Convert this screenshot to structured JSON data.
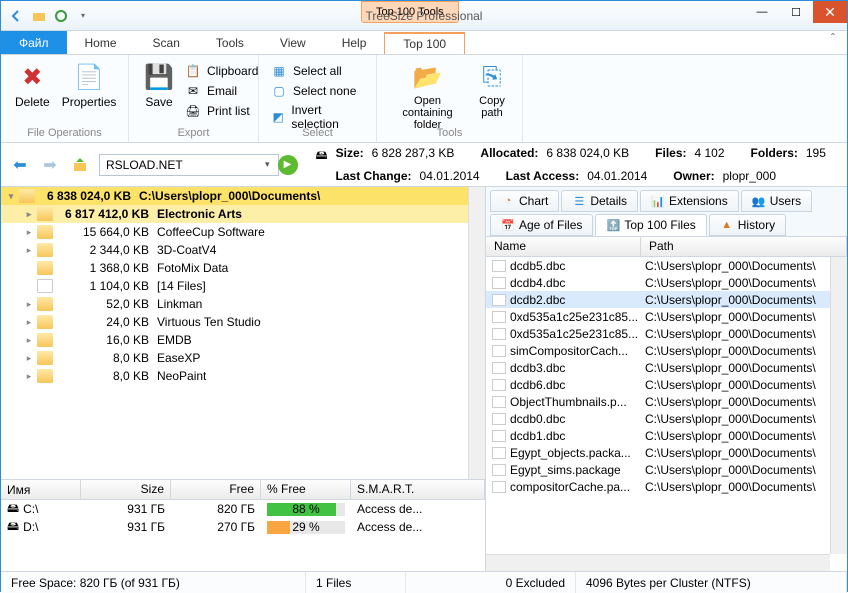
{
  "window": {
    "context_tab": "Top 100 Tools",
    "title": "TreeSize Professional"
  },
  "tabs": {
    "file": "Файл",
    "home": "Home",
    "scan": "Scan",
    "tools": "Tools",
    "view": "View",
    "help": "Help",
    "top100": "Top 100"
  },
  "ribbon": {
    "delete": "Delete",
    "properties": "Properties",
    "save": "Save",
    "clipboard": "Clipboard",
    "email": "Email",
    "printlist": "Print list",
    "selectall": "Select all",
    "selectnone": "Select none",
    "invert": "Invert selection",
    "openfolder": "Open containing\nfolder",
    "copypath": "Copy\npath",
    "g_fileops": "File Operations",
    "g_export": "Export",
    "g_select": "Select",
    "g_tools": "Tools"
  },
  "address": "RSLOAD.NET",
  "info": {
    "size_lbl": "Size:",
    "size": "6 828 287,3 KB",
    "alloc_lbl": "Allocated:",
    "alloc": "6 838 024,0 KB",
    "files_lbl": "Files:",
    "files": "4 102",
    "folders_lbl": "Folders:",
    "folders": "195",
    "lc_lbl": "Last Change:",
    "lc": "04.01.2014",
    "la_lbl": "Last Access:",
    "la": "04.01.2014",
    "owner_lbl": "Owner:",
    "owner": "plopr_000"
  },
  "tree": [
    {
      "sel": 1,
      "ind": 0,
      "exp": "▾",
      "size": "6 838 024,0 KB",
      "name": "C:\\Users\\plopr_000\\Documents\\",
      "bold": true
    },
    {
      "sel": 2,
      "ind": 1,
      "exp": "▸",
      "size": "6 817 412,0 KB",
      "name": "Electronic Arts",
      "bold": true
    },
    {
      "ind": 1,
      "exp": "▸",
      "size": "15 664,0 KB",
      "name": "CoffeeCup Software"
    },
    {
      "ind": 1,
      "exp": "▸",
      "size": "2 344,0 KB",
      "name": "3D-CoatV4"
    },
    {
      "ind": 1,
      "exp": "",
      "size": "1 368,0 KB",
      "name": "FotoMix Data"
    },
    {
      "ind": 1,
      "exp": "",
      "size": "1 104,0 KB",
      "name": "[14 Files]",
      "file": true
    },
    {
      "ind": 1,
      "exp": "▸",
      "size": "52,0 KB",
      "name": "Linkman"
    },
    {
      "ind": 1,
      "exp": "▸",
      "size": "24,0 KB",
      "name": "Virtuous Ten Studio"
    },
    {
      "ind": 1,
      "exp": "▸",
      "size": "16,0 KB",
      "name": "EMDB"
    },
    {
      "ind": 1,
      "exp": "▸",
      "size": "8,0 KB",
      "name": "EaseXP"
    },
    {
      "ind": 1,
      "exp": "▸",
      "size": "8,0 KB",
      "name": "NeoPaint"
    }
  ],
  "drives": {
    "hdr": {
      "name": "Имя",
      "size": "Size",
      "free": "Free",
      "pfree": "% Free",
      "smart": "S.M.A.R.T."
    },
    "rows": [
      {
        "name": "C:\\",
        "size": "931 ГБ",
        "free": "820 ГБ",
        "pct": "88 %",
        "pctv": 88,
        "smart": "Access de..."
      },
      {
        "name": "D:\\",
        "size": "931 ГБ",
        "free": "270 ГБ",
        "pct": "29 %",
        "pctv": 29,
        "smart": "Access de..."
      }
    ]
  },
  "ptabs": {
    "chart": "Chart",
    "details": "Details",
    "ext": "Extensions",
    "users": "Users",
    "age": "Age of Files",
    "top100": "Top 100 Files",
    "history": "History"
  },
  "filelist": {
    "hdr": {
      "name": "Name",
      "path": "Path"
    },
    "rows": [
      {
        "n": "dcdb5.dbc",
        "p": "C:\\Users\\plopr_000\\Documents\\"
      },
      {
        "n": "dcdb4.dbc",
        "p": "C:\\Users\\plopr_000\\Documents\\"
      },
      {
        "n": "dcdb2.dbc",
        "p": "C:\\Users\\plopr_000\\Documents\\",
        "sel": true
      },
      {
        "n": "0xd535a1c25e231c85...",
        "p": "C:\\Users\\plopr_000\\Documents\\"
      },
      {
        "n": "0xd535a1c25e231c85...",
        "p": "C:\\Users\\plopr_000\\Documents\\"
      },
      {
        "n": "simCompositorCach...",
        "p": "C:\\Users\\plopr_000\\Documents\\"
      },
      {
        "n": "dcdb3.dbc",
        "p": "C:\\Users\\plopr_000\\Documents\\"
      },
      {
        "n": "dcdb6.dbc",
        "p": "C:\\Users\\plopr_000\\Documents\\"
      },
      {
        "n": "ObjectThumbnails.p...",
        "p": "C:\\Users\\plopr_000\\Documents\\"
      },
      {
        "n": "dcdb0.dbc",
        "p": "C:\\Users\\plopr_000\\Documents\\"
      },
      {
        "n": "dcdb1.dbc",
        "p": "C:\\Users\\plopr_000\\Documents\\"
      },
      {
        "n": "Egypt_objects.packa...",
        "p": "C:\\Users\\plopr_000\\Documents\\"
      },
      {
        "n": "Egypt_sims.package",
        "p": "C:\\Users\\plopr_000\\Documents\\"
      },
      {
        "n": "compositorCache.pa...",
        "p": "C:\\Users\\plopr_000\\Documents\\"
      }
    ]
  },
  "status": {
    "freespace": "Free Space: 820 ГБ  (of 931 ГБ)",
    "files": "1  Files",
    "excluded": "0 Excluded",
    "cluster": "4096 Bytes per Cluster (NTFS)"
  }
}
